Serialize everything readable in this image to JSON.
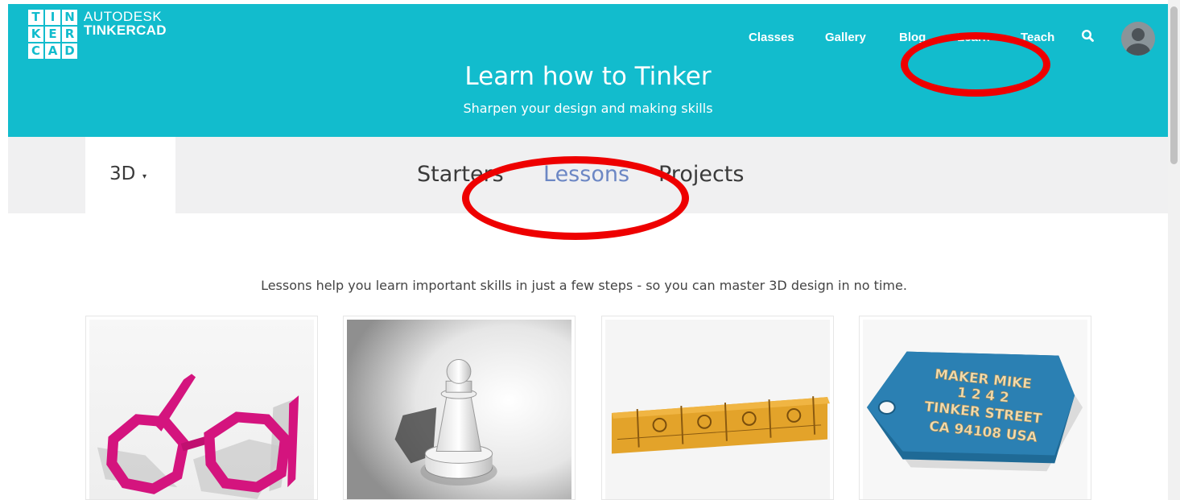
{
  "logo": {
    "letters": [
      "T",
      "I",
      "N",
      "K",
      "E",
      "R",
      "C",
      "A",
      "D"
    ],
    "brand": "AUTODESK",
    "product": "TINKERCAD"
  },
  "nav": {
    "items": [
      {
        "label": "Classes"
      },
      {
        "label": "Gallery"
      },
      {
        "label": "Blog"
      },
      {
        "label": "Learn"
      },
      {
        "label": "Teach"
      }
    ],
    "search_icon": "search-icon",
    "avatar_icon": "user-avatar"
  },
  "hero": {
    "title": "Learn how to Tinker",
    "subtitle": "Sharpen your design and making skills"
  },
  "tabs": {
    "category": "3D",
    "caret": "▾",
    "items": [
      {
        "label": "Starters",
        "active": false
      },
      {
        "label": "Lessons",
        "active": true
      },
      {
        "label": "Projects",
        "active": false
      }
    ]
  },
  "intro": "Lessons help you learn important skills in just a few steps - so you can master 3D design in no time.",
  "cards": [
    {
      "image": "pixel-glasses"
    },
    {
      "image": "chess-pawn"
    },
    {
      "image": "ruler"
    },
    {
      "image": "name-tag",
      "tag_lines": [
        "MAKER MIKE",
        "1 2 4 2",
        "TINKER STREET",
        "CA 94108 USA"
      ]
    }
  ],
  "colors": {
    "header": "#12bccd",
    "tab_active": "#6c87c4",
    "annotation": "#ee0000"
  }
}
